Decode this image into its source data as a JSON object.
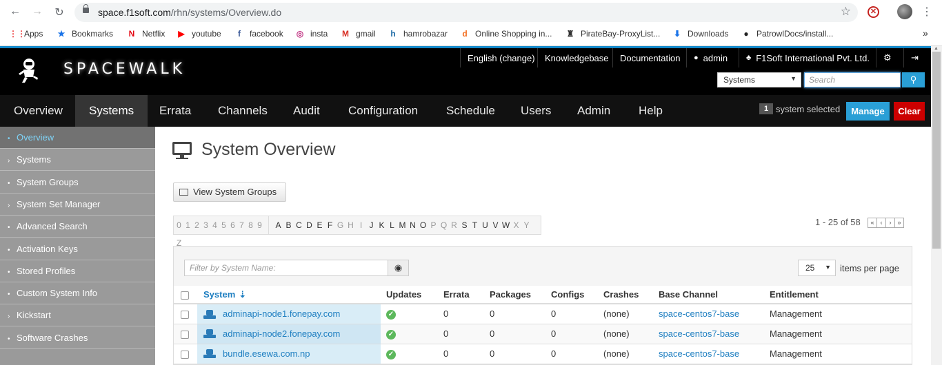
{
  "browser": {
    "url_host": "space.f1soft.com",
    "url_path": "/rhn/systems/Overview.do",
    "bookmarks": [
      {
        "label": "Apps",
        "icon": "apps-grid-icon"
      },
      {
        "label": "Bookmarks",
        "icon": "star-icon"
      },
      {
        "label": "Netflix",
        "icon": "netflix-icon"
      },
      {
        "label": "youtube",
        "icon": "youtube-icon"
      },
      {
        "label": "facebook",
        "icon": "facebook-icon"
      },
      {
        "label": "insta",
        "icon": "instagram-icon"
      },
      {
        "label": "gmail",
        "icon": "gmail-icon"
      },
      {
        "label": "hamrobazar",
        "icon": "hamrobazar-icon"
      },
      {
        "label": "Online Shopping in...",
        "icon": "daraz-icon"
      },
      {
        "label": "PirateBay-ProxyList...",
        "icon": "pirate-ship-icon"
      },
      {
        "label": "Downloads",
        "icon": "download-icon"
      },
      {
        "label": "PatrowlDocs/install...",
        "icon": "github-icon"
      }
    ],
    "more": "»"
  },
  "header": {
    "logo_text": "SPACEWALK",
    "utility": {
      "language": "English (change)",
      "knowledgebase": "Knowledgebase",
      "documentation": "Documentation",
      "user": "admin",
      "org": "F1Soft International Pvt. Ltd."
    },
    "search": {
      "scope": "Systems",
      "placeholder": "Search"
    }
  },
  "nav": {
    "items": [
      "Overview",
      "Systems",
      "Errata",
      "Channels",
      "Audit",
      "Configuration",
      "Schedule",
      "Users",
      "Admin",
      "Help"
    ],
    "active": "Systems",
    "selected_count": "1",
    "selected_label": "system selected",
    "manage": "Manage",
    "clear": "Clear"
  },
  "sidebar": {
    "items": [
      {
        "label": "Overview",
        "marker": "•",
        "active": true
      },
      {
        "label": "Systems",
        "marker": "›"
      },
      {
        "label": "System Groups",
        "marker": "•"
      },
      {
        "label": "System Set Manager",
        "marker": "›"
      },
      {
        "label": "Advanced Search",
        "marker": "•"
      },
      {
        "label": "Activation Keys",
        "marker": "•"
      },
      {
        "label": "Stored Profiles",
        "marker": "•"
      },
      {
        "label": "Custom System Info",
        "marker": "•"
      },
      {
        "label": "Kickstart",
        "marker": "›"
      },
      {
        "label": "Software Crashes",
        "marker": "•"
      }
    ]
  },
  "main": {
    "title": "System Overview",
    "view_groups_button": "View System Groups",
    "alpha_digits": [
      "0",
      "1",
      "2",
      "3",
      "4",
      "5",
      "6",
      "7",
      "8",
      "9"
    ],
    "alpha_letters": [
      {
        "c": "A",
        "e": true
      },
      {
        "c": "B",
        "e": true
      },
      {
        "c": "C",
        "e": true
      },
      {
        "c": "D",
        "e": true
      },
      {
        "c": "E",
        "e": true
      },
      {
        "c": "F",
        "e": true
      },
      {
        "c": "G",
        "e": false
      },
      {
        "c": "H",
        "e": false
      },
      {
        "c": "I",
        "e": false
      },
      {
        "c": "J",
        "e": true
      },
      {
        "c": "K",
        "e": true
      },
      {
        "c": "L",
        "e": true
      },
      {
        "c": "M",
        "e": true
      },
      {
        "c": "N",
        "e": true
      },
      {
        "c": "O",
        "e": true
      },
      {
        "c": "P",
        "e": false
      },
      {
        "c": "Q",
        "e": false
      },
      {
        "c": "R",
        "e": false
      },
      {
        "c": "S",
        "e": true
      },
      {
        "c": "T",
        "e": true
      },
      {
        "c": "U",
        "e": true
      },
      {
        "c": "V",
        "e": true
      },
      {
        "c": "W",
        "e": true
      },
      {
        "c": "X",
        "e": false
      },
      {
        "c": "Y",
        "e": false
      },
      {
        "c": "Z",
        "e": false
      }
    ],
    "pager_text": "1 - 25 of 58",
    "filter_placeholder": "Filter by System Name:",
    "per_page_value": "25",
    "per_page_label": "items per page",
    "columns": [
      "System",
      "Updates",
      "Errata",
      "Packages",
      "Configs",
      "Crashes",
      "Base Channel",
      "Entitlement"
    ],
    "rows": [
      {
        "system": "adminapi-node1.fonepay.com",
        "errata": "0",
        "packages": "0",
        "configs": "0",
        "crashes": "(none)",
        "channel": "space-centos7-base",
        "entitlement": "Management"
      },
      {
        "system": "adminapi-node2.fonepay.com",
        "errata": "0",
        "packages": "0",
        "configs": "0",
        "crashes": "(none)",
        "channel": "space-centos7-base",
        "entitlement": "Management"
      },
      {
        "system": "bundle.esewa.com.np",
        "errata": "0",
        "packages": "0",
        "configs": "0",
        "crashes": "(none)",
        "channel": "space-centos7-base",
        "entitlement": "Management"
      }
    ]
  }
}
